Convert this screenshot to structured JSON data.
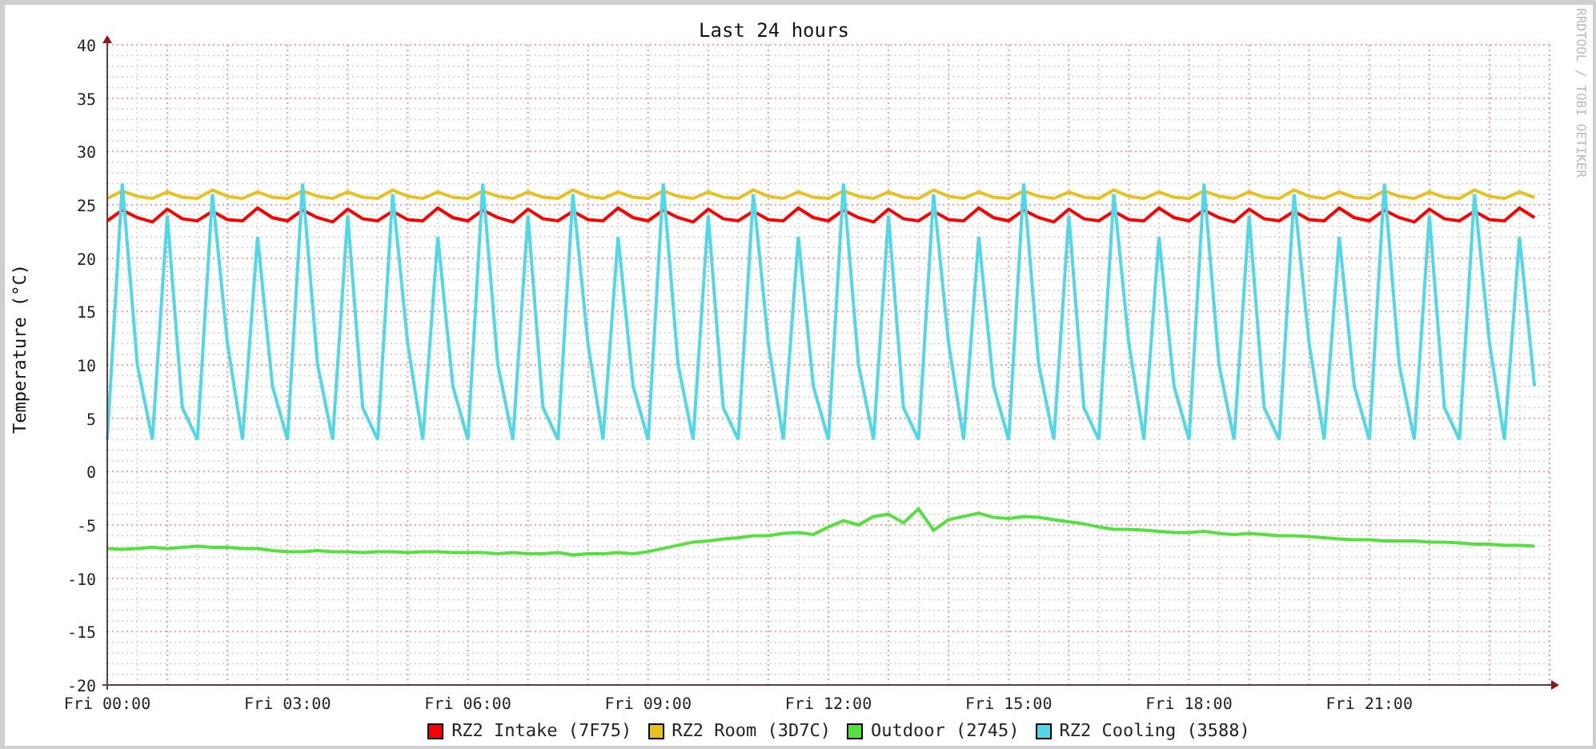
{
  "chart_data": {
    "type": "line",
    "title": "Last 24 hours",
    "ylabel": "Temperature (°C)",
    "ylim": [
      -20,
      40
    ],
    "grid": true,
    "categories": [
      "Fri 00:00",
      null,
      null,
      null,
      null,
      null,
      null,
      null,
      null,
      null,
      null,
      null,
      "Fri 03:00",
      null,
      null,
      null,
      null,
      null,
      null,
      null,
      null,
      null,
      null,
      null,
      "Fri 06:00",
      null,
      null,
      null,
      null,
      null,
      null,
      null,
      null,
      null,
      null,
      null,
      "Fri 09:00",
      null,
      null,
      null,
      null,
      null,
      null,
      null,
      null,
      null,
      null,
      null,
      "Fri 12:00",
      null,
      null,
      null,
      null,
      null,
      null,
      null,
      null,
      null,
      null,
      null,
      "Fri 15:00",
      null,
      null,
      null,
      null,
      null,
      null,
      null,
      null,
      null,
      null,
      null,
      "Fri 18:00",
      null,
      null,
      null,
      null,
      null,
      null,
      null,
      null,
      null,
      null,
      null,
      "Fri 21:00",
      null,
      null,
      null,
      null,
      null,
      null,
      null,
      null,
      null,
      null,
      null
    ],
    "yticks": [
      -20,
      -15,
      -10,
      -5,
      0,
      5,
      10,
      15,
      20,
      25,
      30,
      35,
      40
    ],
    "series": [
      {
        "name": "RZ2 Intake (7F75)",
        "color": "#ff0000",
        "values": [
          23.5,
          24.5,
          23.8,
          23.4,
          24.6,
          23.7,
          23.5,
          24.4,
          23.6,
          23.5,
          24.7,
          23.8,
          23.5,
          24.5,
          23.8,
          23.4,
          24.6,
          23.7,
          23.5,
          24.4,
          23.6,
          23.5,
          24.7,
          23.8,
          23.5,
          24.5,
          23.8,
          23.4,
          24.6,
          23.7,
          23.5,
          24.4,
          23.6,
          23.5,
          24.7,
          23.8,
          23.5,
          24.5,
          23.8,
          23.4,
          24.6,
          23.7,
          23.5,
          24.4,
          23.6,
          23.5,
          24.7,
          23.8,
          23.5,
          24.5,
          23.8,
          23.4,
          24.6,
          23.7,
          23.5,
          24.4,
          23.6,
          23.5,
          24.7,
          23.8,
          23.5,
          24.5,
          23.8,
          23.4,
          24.6,
          23.7,
          23.5,
          24.4,
          23.6,
          23.5,
          24.7,
          23.8,
          23.5,
          24.5,
          23.8,
          23.4,
          24.6,
          23.7,
          23.5,
          24.4,
          23.6,
          23.5,
          24.7,
          23.8,
          23.5,
          24.5,
          23.8,
          23.4,
          24.6,
          23.7,
          23.5,
          24.4,
          23.6,
          23.5,
          24.7,
          23.8
        ]
      },
      {
        "name": "RZ2 Room (3D7C)",
        "color": "#e8c020",
        "values": [
          25.6,
          26.3,
          25.8,
          25.6,
          26.2,
          25.7,
          25.6,
          26.4,
          25.8,
          25.6,
          26.2,
          25.7,
          25.6,
          26.3,
          25.8,
          25.6,
          26.2,
          25.7,
          25.6,
          26.4,
          25.8,
          25.6,
          26.2,
          25.7,
          25.6,
          26.3,
          25.8,
          25.6,
          26.2,
          25.7,
          25.6,
          26.4,
          25.8,
          25.6,
          26.2,
          25.7,
          25.6,
          26.3,
          25.8,
          25.6,
          26.2,
          25.7,
          25.6,
          26.4,
          25.8,
          25.6,
          26.2,
          25.7,
          25.6,
          26.3,
          25.8,
          25.6,
          26.2,
          25.7,
          25.6,
          26.4,
          25.8,
          25.6,
          26.2,
          25.7,
          25.6,
          26.3,
          25.8,
          25.6,
          26.2,
          25.7,
          25.6,
          26.4,
          25.8,
          25.6,
          26.2,
          25.7,
          25.6,
          26.3,
          25.8,
          25.6,
          26.2,
          25.7,
          25.6,
          26.4,
          25.8,
          25.6,
          26.2,
          25.7,
          25.6,
          26.3,
          25.8,
          25.6,
          26.2,
          25.7,
          25.6,
          26.4,
          25.8,
          25.6,
          26.2,
          25.7
        ]
      },
      {
        "name": "Outdoor (2745)",
        "color": "#55e040",
        "values": [
          -7.2,
          -7.3,
          -7.2,
          -7.1,
          -7.2,
          -7.1,
          -7.0,
          -7.1,
          -7.1,
          -7.2,
          -7.2,
          -7.4,
          -7.5,
          -7.5,
          -7.4,
          -7.5,
          -7.5,
          -7.6,
          -7.5,
          -7.5,
          -7.6,
          -7.5,
          -7.5,
          -7.6,
          -7.6,
          -7.6,
          -7.7,
          -7.6,
          -7.7,
          -7.7,
          -7.6,
          -7.8,
          -7.7,
          -7.7,
          -7.6,
          -7.7,
          -7.5,
          -7.2,
          -6.9,
          -6.6,
          -6.5,
          -6.3,
          -6.2,
          -6.0,
          -6.0,
          -5.8,
          -5.7,
          -5.9,
          -5.2,
          -4.6,
          -5.0,
          -4.2,
          -4.0,
          -4.8,
          -3.5,
          -5.5,
          -4.5,
          -4.2,
          -3.9,
          -4.3,
          -4.4,
          -4.2,
          -4.3,
          -4.5,
          -4.7,
          -4.9,
          -5.2,
          -5.4,
          -5.4,
          -5.5,
          -5.6,
          -5.7,
          -5.7,
          -5.6,
          -5.8,
          -5.9,
          -5.8,
          -5.9,
          -6.0,
          -6.0,
          -6.1,
          -6.2,
          -6.3,
          -6.4,
          -6.4,
          -6.5,
          -6.5,
          -6.5,
          -6.6,
          -6.6,
          -6.7,
          -6.8,
          -6.8,
          -6.9,
          -6.9,
          -7.0
        ]
      },
      {
        "name": "RZ2 Cooling (3588)",
        "color": "#50d8e8",
        "values": [
          3,
          27,
          10,
          3,
          24,
          6,
          3,
          26,
          12,
          3,
          22,
          8,
          3,
          27,
          10,
          3,
          24,
          6,
          3,
          26,
          12,
          3,
          22,
          8,
          3,
          27,
          10,
          3,
          24,
          6,
          3,
          26,
          12,
          3,
          22,
          8,
          3,
          27,
          10,
          3,
          24,
          6,
          3,
          26,
          12,
          3,
          22,
          8,
          3,
          27,
          10,
          3,
          24,
          6,
          3,
          26,
          12,
          3,
          22,
          8,
          3,
          27,
          10,
          3,
          24,
          6,
          3,
          26,
          12,
          3,
          22,
          8,
          3,
          27,
          10,
          3,
          24,
          6,
          3,
          26,
          12,
          3,
          22,
          8,
          3,
          27,
          10,
          3,
          24,
          6,
          3,
          26,
          12,
          3,
          22,
          8
        ]
      }
    ]
  },
  "credit": "RRDTOOL / TOBI OETIKER"
}
